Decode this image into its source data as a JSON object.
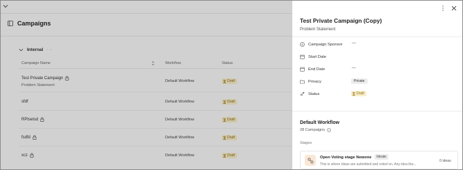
{
  "left": {
    "page_title": "Campaigns",
    "group": {
      "name": "Internal",
      "more": "···"
    },
    "columns": {
      "name": "Campaign Name",
      "workflow": "Workflow",
      "status": "Status"
    },
    "rows": [
      {
        "name": "Test Private Campaign",
        "subtitle": "Problem Statement",
        "locked": true,
        "workflow": "Default Workflow",
        "status": "Draft"
      },
      {
        "name": "sfdf",
        "subtitle": "",
        "locked": false,
        "workflow": "Default Workflow",
        "status": "Draft"
      },
      {
        "name": "RPtsetsd",
        "subtitle": "",
        "locked": true,
        "workflow": "Default Workflow",
        "status": "Draft"
      },
      {
        "name": "fsdfd",
        "subtitle": "",
        "locked": true,
        "workflow": "Default Workflow",
        "status": "Draft"
      },
      {
        "name": "xcz",
        "subtitle": "",
        "locked": true,
        "workflow": "Default Workflow",
        "status": "Draft"
      }
    ]
  },
  "panel": {
    "title": "Test Private Campaign (Copy)",
    "subtitle": "Problem Statement",
    "props": {
      "sponsor_label": "Campaign Sponsor",
      "sponsor_value": "—",
      "start_label": "Start Date",
      "start_value": "",
      "end_label": "End Date",
      "end_value": "—",
      "privacy_label": "Privacy",
      "privacy_value": "Private",
      "status_label": "Status",
      "status_value": "Draft"
    },
    "workflow": {
      "title": "Default Workflow",
      "count": "28 Campaigns",
      "stages_label": "Stages",
      "stage": {
        "name": "Open Voting stage Newone",
        "badge": "Ideate",
        "description": "This is where ideas are submitted and voted on. Any idea tha...",
        "ideas": "0 ideas"
      }
    }
  },
  "colors": {
    "draft_bg": "#f8edc9",
    "draft_text": "#8a6a10",
    "overlay": "rgba(0,0,0,0.16)",
    "stage_icon_bg": "#fbe7d6"
  },
  "icons": [
    "chevron-down-icon",
    "sidebar-icon",
    "lock-icon",
    "hourglass-icon",
    "sort-icon",
    "more-vertical-icon",
    "close-icon",
    "sponsor-icon",
    "calendar-icon",
    "folder-icon",
    "rocket-icon",
    "info-icon",
    "stage-icon"
  ]
}
